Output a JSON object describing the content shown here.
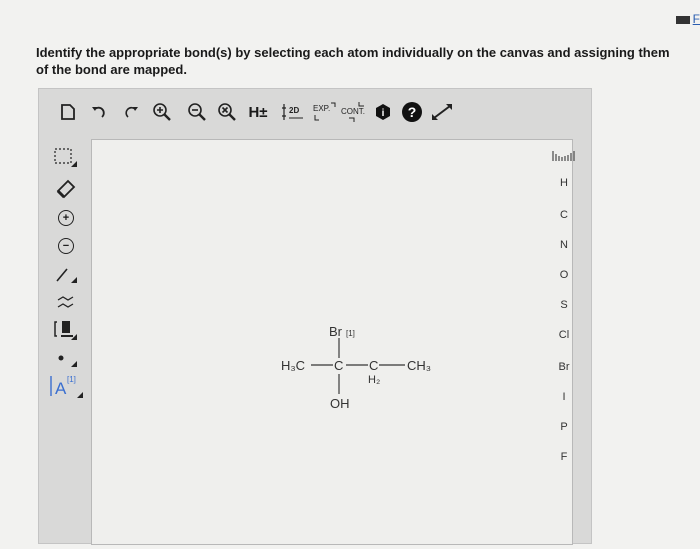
{
  "topbar": {
    "link_text": "F"
  },
  "question": {
    "line1": "Identify the appropriate bond(s) by selecting each atom individually on the canvas and assigning them",
    "line2": "of the bond are mapped."
  },
  "toolbar": {
    "h_label": "H±",
    "twod_label": "2D",
    "exp_label": "EXP.",
    "cont_label": "CONT."
  },
  "left_tools": {
    "plus": "+",
    "minus": "−",
    "chain": "≄",
    "atom_map": "A",
    "atom_map_num": "[1]"
  },
  "atom_palette": [
    "H",
    "C",
    "N",
    "O",
    "S",
    "Cl",
    "Br",
    "I",
    "P",
    "F"
  ],
  "molecule": {
    "br": "Br",
    "br_map": "[1]",
    "h3c": "H₃C",
    "c1": "C",
    "c2": "C",
    "h2": "H₂",
    "ch3": "CH₃",
    "oh": "OH"
  }
}
